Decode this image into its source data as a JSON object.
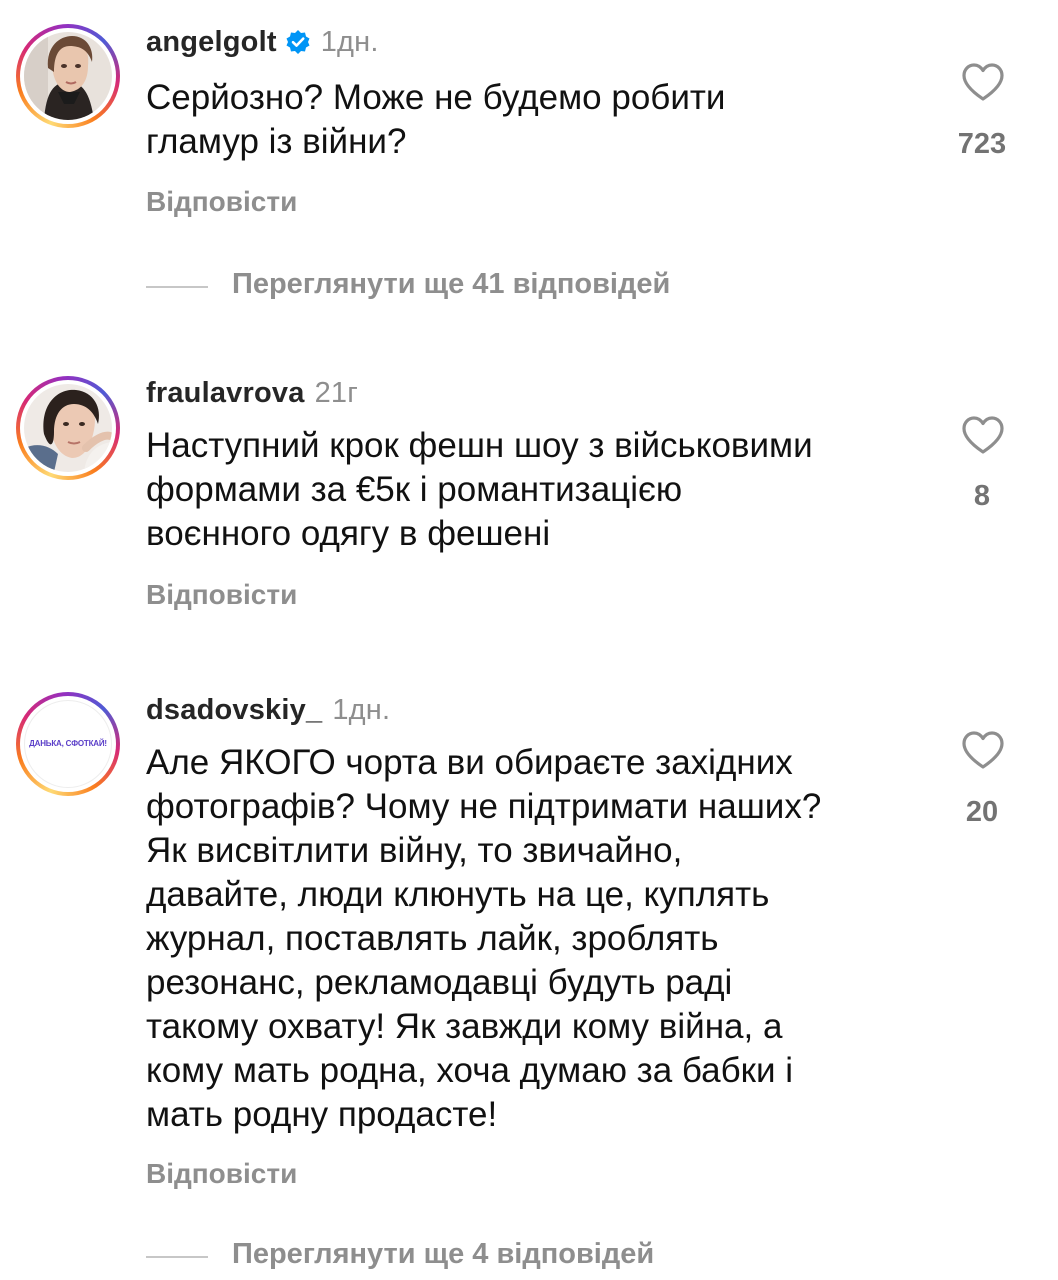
{
  "comments": [
    {
      "username": "angelgolt",
      "verified": true,
      "time": "1дн.",
      "text_lines": [
        "Серйозно? Може не будемо робити",
        "гламур із війни?"
      ],
      "likes": "723",
      "reply_label": "Відповісти",
      "view_replies": "Переглянути ще 41 відповідей"
    },
    {
      "username": "fraulavrova",
      "verified": false,
      "time": "21г",
      "text_lines": [
        "Наступний крок фешн шоу з військовими",
        "формами за €5к і романтизацією",
        "воєнного одягу в фешені"
      ],
      "likes": "8",
      "reply_label": "Відповісти"
    },
    {
      "username": "dsadovskiy_",
      "verified": false,
      "time": "1дн.",
      "avatar_text": "ДАНЬКА, СФОТКАЙ!",
      "text_lines": [
        "Але ЯКОГО чорта ви обираєте західних",
        "фотографів? Чому не підтримати наших?",
        "Як висвітлити війну, то звичайно,",
        "давайте, люди клюнуть на це, куплять",
        "журнал, поставлять лайк, зроблять",
        "резонанс, рекламодавці будуть раді",
        "такому охвату! Як завжди кому війна, а",
        "кому мать родна, хоча думаю за бабки і",
        "мать родну продасте!"
      ],
      "likes": "20",
      "reply_label": "Відповісти",
      "view_replies": "Переглянути ще 4 відповідей"
    }
  ],
  "colors": {
    "text": "#111111",
    "username": "#262626",
    "secondary": "#8e8e8e",
    "like_count": "#737373",
    "verified_badge": "#0095f6",
    "divider": "#c7c7c7"
  },
  "icons": {
    "like": "heart-outline-icon",
    "verified": "verified-badge-icon"
  }
}
